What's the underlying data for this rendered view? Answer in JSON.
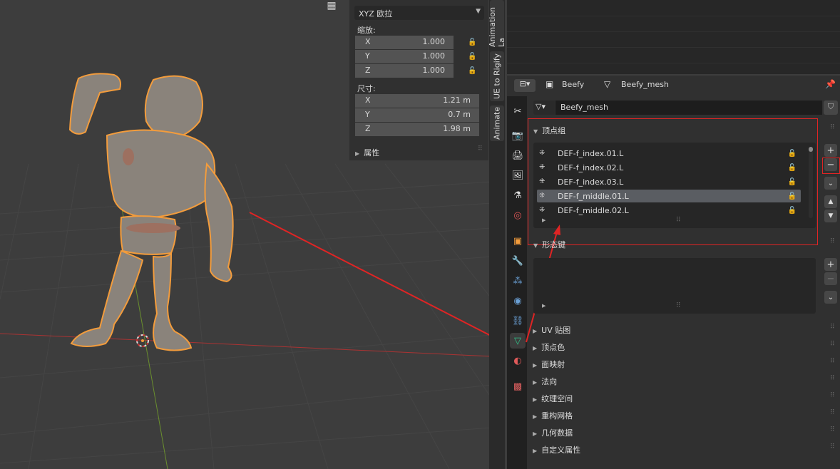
{
  "viewport": {
    "grid_icon": "grid-icon"
  },
  "npanel": {
    "rotation_mode": "XYZ 欧拉",
    "scale_label": "缩放:",
    "scale": [
      {
        "axis": "X",
        "value": "1.000"
      },
      {
        "axis": "Y",
        "value": "1.000"
      },
      {
        "axis": "Z",
        "value": "1.000"
      }
    ],
    "dimensions_label": "尺寸:",
    "dimensions": [
      {
        "axis": "X",
        "value": "1.21 m"
      },
      {
        "axis": "Y",
        "value": "0.7 m"
      },
      {
        "axis": "Z",
        "value": "1.98 m"
      }
    ],
    "properties_label": "属性"
  },
  "side_tabs": {
    "tab1": "Animation La",
    "tab2": "UE to Rigify",
    "tab3": "Animate"
  },
  "header": {
    "object_name": "Beefy",
    "mesh_name": "Beefy_mesh"
  },
  "data_block": {
    "name": "Beefy_mesh"
  },
  "vertex_groups": {
    "title": "顶点组",
    "items": [
      {
        "name": "DEF-f_index.01.L"
      },
      {
        "name": "DEF-f_index.02.L"
      },
      {
        "name": "DEF-f_index.03.L"
      },
      {
        "name": "DEF-f_middle.01.L"
      },
      {
        "name": "DEF-f_middle.02.L"
      }
    ]
  },
  "shape_keys": {
    "title": "形态键"
  },
  "subpanels": [
    {
      "label": "UV 贴图"
    },
    {
      "label": "顶点色"
    },
    {
      "label": "面映射"
    },
    {
      "label": "法向"
    },
    {
      "label": "纹理空间"
    },
    {
      "label": "重构网格"
    },
    {
      "label": "几何数据"
    },
    {
      "label": "自定义属性"
    }
  ],
  "colors": {
    "accent_orange": "#f39c3c",
    "annotation_red": "#e02424",
    "active_tab_green": "#2fc58a",
    "active_row": "#5a5d62"
  }
}
